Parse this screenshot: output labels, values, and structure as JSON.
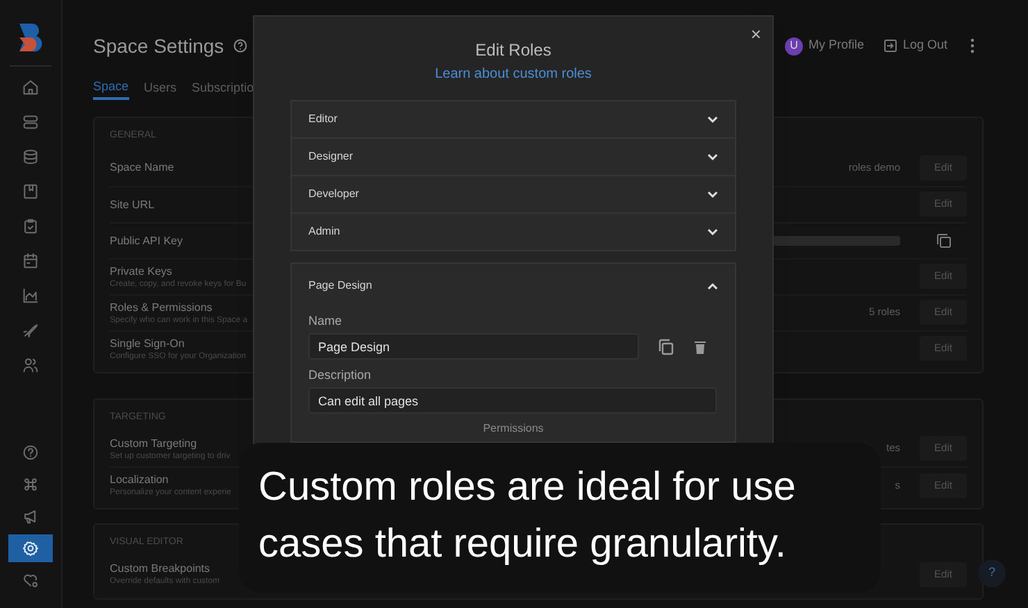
{
  "sidebar": {
    "top_items": [
      {
        "selected": false
      },
      {
        "selected": false
      },
      {
        "selected": false
      },
      {
        "selected": false
      },
      {
        "selected": false
      },
      {
        "selected": false
      },
      {
        "selected": false
      },
      {
        "selected": false
      },
      {
        "selected": false
      }
    ],
    "bottom_items": [
      {
        "selected": false
      },
      {
        "selected": false
      },
      {
        "selected": false
      },
      {
        "selected": true
      },
      {
        "selected": false
      }
    ]
  },
  "header": {
    "title": "Space Settings",
    "profile": {
      "avatar": "U",
      "label": "My Profile"
    },
    "logout": "Log Out"
  },
  "tabs": [
    {
      "label": "Space",
      "selected": true
    },
    {
      "label": "Users",
      "selected": false
    },
    {
      "label": "Subscriptio",
      "selected": false
    }
  ],
  "sections": [
    {
      "heading": "GENERAL",
      "rows": [
        {
          "label": "Space Name",
          "value": "roles demo",
          "kind": "edit",
          "action": "Edit"
        },
        {
          "label": "Site URL",
          "kind": "edit",
          "action": "Edit"
        },
        {
          "label": "Public API Key",
          "kind": "copy"
        },
        {
          "label": "Private Keys",
          "description": "Create, copy, and revoke keys for Bu",
          "kind": "edit",
          "action": "Edit"
        },
        {
          "label": "Roles & Permissions",
          "description": "Specify who can work in this Space a",
          "value": "5 roles",
          "kind": "edit",
          "action": "Edit"
        },
        {
          "label": "Single Sign-On",
          "description": "Configure SSO for your Organization",
          "kind": "edit",
          "action": "Edit"
        }
      ]
    },
    {
      "heading": "TARGETING",
      "rows": [
        {
          "label": "Custom Targeting",
          "description": "Set up customer targeting to driv",
          "value": "tes",
          "kind": "edit",
          "action": "Edit"
        },
        {
          "label": "Localization",
          "description": "Personalize your content experie",
          "value": "s",
          "kind": "edit",
          "action": "Edit"
        }
      ]
    },
    {
      "heading": "VISUAL EDITOR",
      "rows": [
        {
          "label": "Custom Breakpoints",
          "description": "Override defaults with custom",
          "kind": "edit",
          "action": "Edit"
        }
      ]
    }
  ],
  "help_button": "?",
  "modal": {
    "title": "Edit Roles",
    "link": "Learn about custom roles",
    "close": "×",
    "roles": [
      {
        "label": "Editor",
        "expanded": false
      },
      {
        "label": "Designer",
        "expanded": false
      },
      {
        "label": "Developer",
        "expanded": false
      },
      {
        "label": "Admin",
        "expanded": false
      },
      {
        "label": "Page Design",
        "expanded": true
      }
    ],
    "form": {
      "name_label": "Name",
      "name_value": "Page Design",
      "description_label": "Description",
      "description_value": "Can edit all pages",
      "permissions_label": "Permissions"
    }
  },
  "caption": "Custom roles are ideal for use cases that require granularity."
}
